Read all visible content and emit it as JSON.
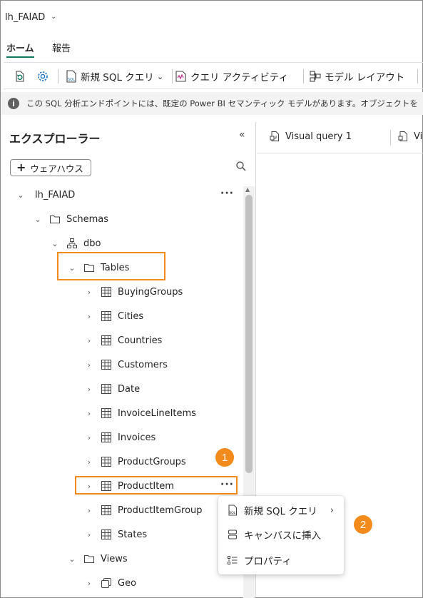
{
  "workspace": {
    "name": "lh_FAIAD"
  },
  "tabs": [
    {
      "label": "ホーム"
    },
    {
      "label": "報告"
    }
  ],
  "toolbar": {
    "new_sql_query": "新規 SQL クエリ",
    "query_activity": "クエリ アクティビティ",
    "model_layout": "モデル レイアウト"
  },
  "info": {
    "message": "この SQL 分析エンドポイントには、既定の Power BI セマンティック モデルがあります。オブジェクトを"
  },
  "explorer": {
    "title": "エクスプローラー",
    "add_warehouse": "ウェアハウス",
    "root": "lh_FAIAD",
    "schemas": "Schemas",
    "dbo": "dbo",
    "tables_folder": "Tables",
    "tables": [
      "BuyingGroups",
      "Cities",
      "Countries",
      "Customers",
      "Date",
      "InvoiceLineItems",
      "Invoices",
      "ProductGroups",
      "ProductItem",
      "ProductItemGroup",
      "States"
    ],
    "views_folder": "Views",
    "views": [
      "Geo"
    ]
  },
  "query_tabs": [
    {
      "label": "Visual query 1"
    },
    {
      "label": "Vi"
    }
  ],
  "context_menu": {
    "new_sql_query": "新規 SQL クエリ",
    "insert_canvas": "キャンバスに挿入",
    "properties": "プロパティ"
  },
  "callouts": [
    "1",
    "2"
  ],
  "colors": {
    "highlight": "#f28a1c",
    "accent": "#117865"
  }
}
